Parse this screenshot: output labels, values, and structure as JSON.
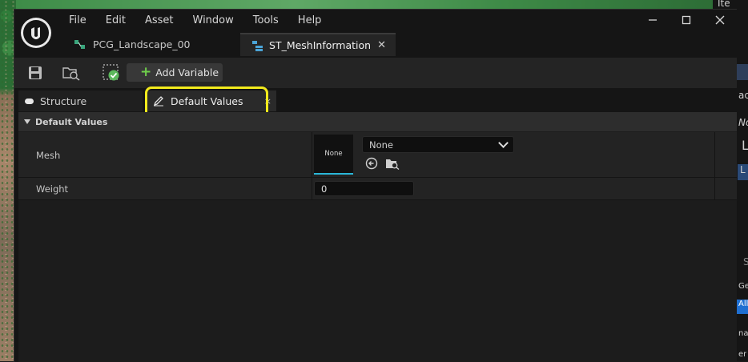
{
  "menu": [
    "File",
    "Edit",
    "Asset",
    "Window",
    "Tools",
    "Help"
  ],
  "document_tabs": [
    {
      "label": "PCG_Landscape_00",
      "active": false
    },
    {
      "label": "ST_MeshInformation",
      "active": true
    }
  ],
  "toolbar": {
    "add_variable_label": "Add Variable"
  },
  "panel_tabs": {
    "structure": "Structure",
    "default_values": "Default Values"
  },
  "section": {
    "title": "Default Values"
  },
  "properties": {
    "mesh": {
      "label": "Mesh",
      "thumbnail_text": "None",
      "value": "None"
    },
    "weight": {
      "label": "Weight",
      "value": "0"
    }
  },
  "right_panel": {
    "labels": [
      "Ite",
      "ac",
      "No",
      "L",
      "L",
      "S",
      "Ge",
      "All",
      "na",
      "er"
    ]
  },
  "colors": {
    "highlight": "#f2ea1c",
    "accent_underline": "#2ab6d8",
    "add_icon": "#6fcf4b"
  }
}
